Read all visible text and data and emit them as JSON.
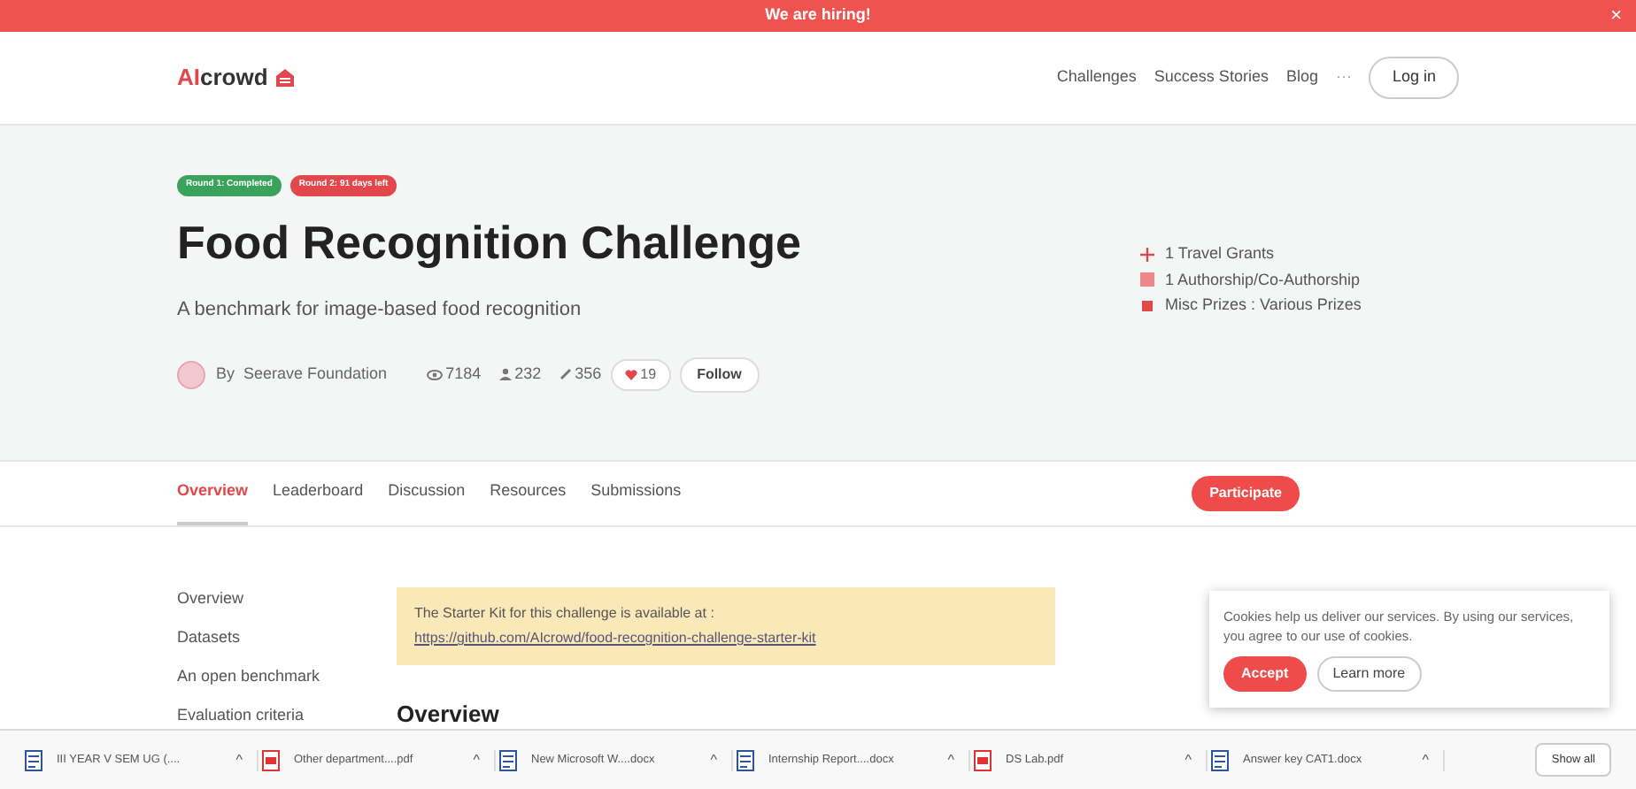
{
  "banner": {
    "text": "We are hiring!",
    "close": "×"
  },
  "header": {
    "logo_ai": "AI",
    "logo_rest": "crowd",
    "nav": [
      "Challenges",
      "Success Stories",
      "Blog"
    ],
    "more": "···",
    "login": "Log in"
  },
  "hero": {
    "badges": [
      {
        "text": "Round 1: Completed",
        "color": "#3aa35b"
      },
      {
        "text": "Round 2: 91 days left",
        "color": "#e2474c"
      }
    ],
    "title": "Food Recognition Challenge",
    "subtitle": "A benchmark for image-based food recognition",
    "organizer": "By  Seerave Foundation",
    "views": "7184",
    "participants": "232",
    "submissions": "356",
    "likes": "19",
    "follow": "Follow",
    "prizes": [
      {
        "kind": "plus",
        "text": "1 Travel Grants"
      },
      {
        "kind": "paper",
        "text": "1 Authorship/Co-Authorship"
      },
      {
        "kind": "square",
        "text": "Misc Prizes : Various Prizes"
      }
    ]
  },
  "tabs": [
    {
      "label": "Overview",
      "selected": true
    },
    {
      "label": "Leaderboard",
      "selected": false
    },
    {
      "label": "Discussion",
      "selected": false
    },
    {
      "label": "Resources",
      "selected": false
    },
    {
      "label": "Submissions",
      "selected": false
    }
  ],
  "participate": "Participate",
  "sidebar": [
    "Overview",
    "Datasets",
    "An open benchmark",
    "Evaluation criteria"
  ],
  "notice": {
    "text": "The Starter Kit for this challenge is available at : ",
    "link": "https://github.com/AIcrowd/food-recognition-challenge-starter-kit"
  },
  "section_heading": "Overview",
  "cookie": {
    "text": "Cookies help us deliver our services. By using our services, you agree to our use of cookies.",
    "accept": "Accept",
    "learn": "Learn more"
  },
  "downloads": [
    {
      "kind": "doc",
      "name": "III YEAR V SEM UG (....",
      "caret": "^"
    },
    {
      "kind": "pdf",
      "name": "Other department....pdf",
      "caret": "^"
    },
    {
      "kind": "doc",
      "name": "New Microsoft W....docx",
      "caret": "^"
    },
    {
      "kind": "doc",
      "name": "Internship Report....docx",
      "caret": "^"
    },
    {
      "kind": "pdf",
      "name": "DS Lab.pdf",
      "caret": "^"
    },
    {
      "kind": "doc",
      "name": "Answer key CAT1.docx",
      "caret": "^"
    }
  ],
  "show_all": "Show all"
}
